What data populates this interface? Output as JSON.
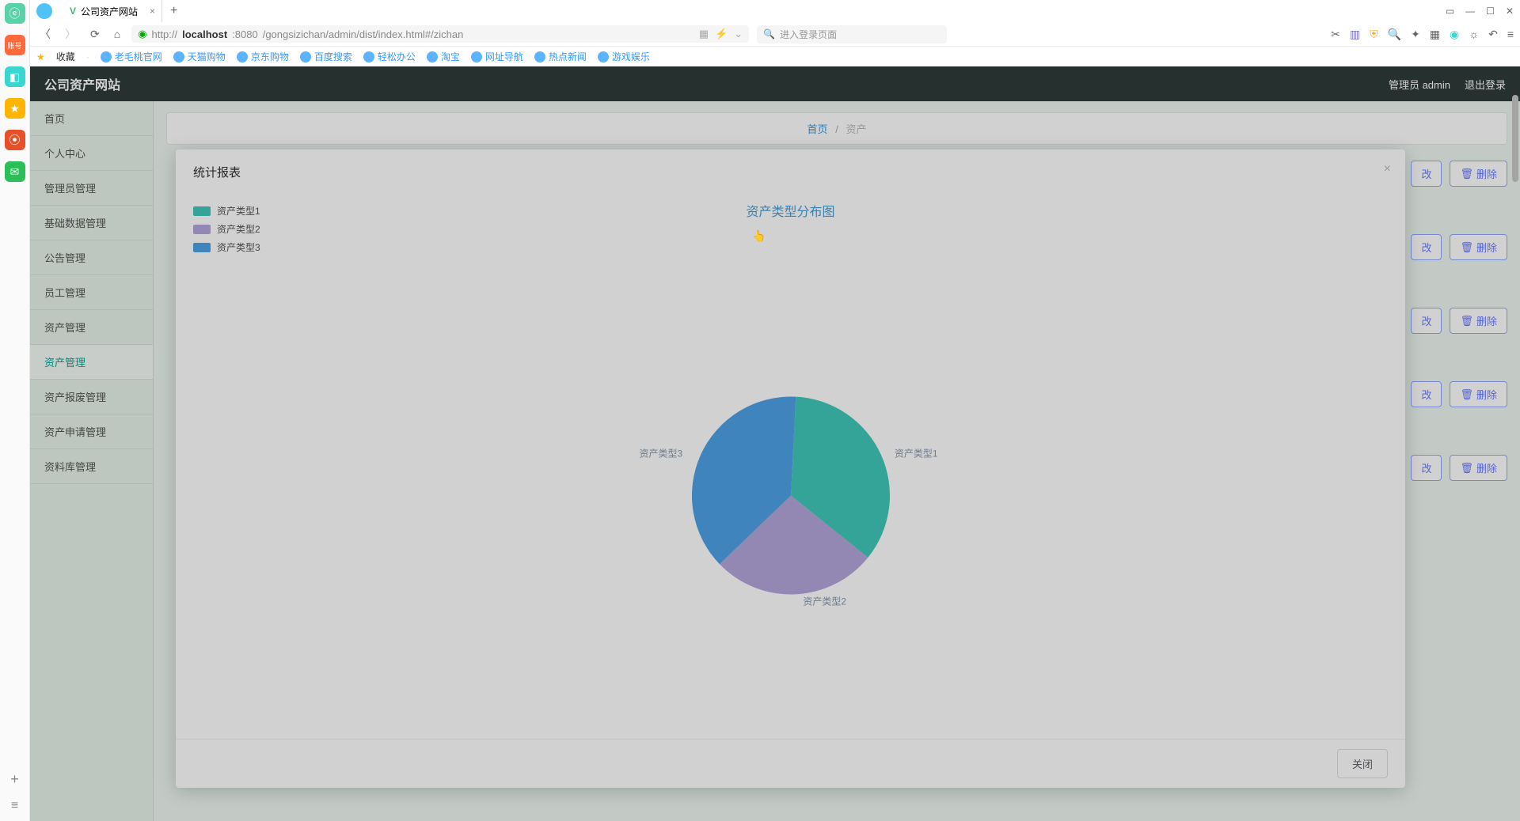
{
  "browser": {
    "tab_title": "公司资产网站",
    "url_prefix": "http://",
    "url_host": "localhost",
    "url_port": ":8080",
    "url_path": "/gongsizichan/admin/dist/index.html#/zichan",
    "search_placeholder": "进入登录页面",
    "fav_label": "收藏",
    "bookmarks": [
      "老毛桃官网",
      "天猫购物",
      "京东购物",
      "百度搜索",
      "轻松办公",
      "淘宝",
      "网址导航",
      "热点新闻",
      "游戏娱乐"
    ]
  },
  "app": {
    "title": "公司资产网站",
    "user_label": "管理员 admin",
    "logout": "退出登录",
    "breadcrumb_home": "首页",
    "breadcrumb_current": "资产",
    "sidebar": [
      "首页",
      "个人中心",
      "管理员管理",
      "基础数据管理",
      "公告管理",
      "员工管理",
      "资产管理",
      "资产管理",
      "资产报废管理",
      "资产申请管理",
      "资料库管理"
    ],
    "sidebar_active_index": 7,
    "btn_edit": "改",
    "btn_delete": "删除"
  },
  "modal": {
    "title": "统计报表",
    "close_btn": "关闭"
  },
  "chart_data": {
    "type": "pie",
    "title": "资产类型分布图",
    "series": [
      {
        "name": "资产类型1",
        "value": 35,
        "color": "#3fc8b9"
      },
      {
        "name": "资产类型2",
        "value": 27,
        "color": "#b4a7db"
      },
      {
        "name": "资产类型3",
        "value": 38,
        "color": "#4ea2e6"
      }
    ]
  }
}
